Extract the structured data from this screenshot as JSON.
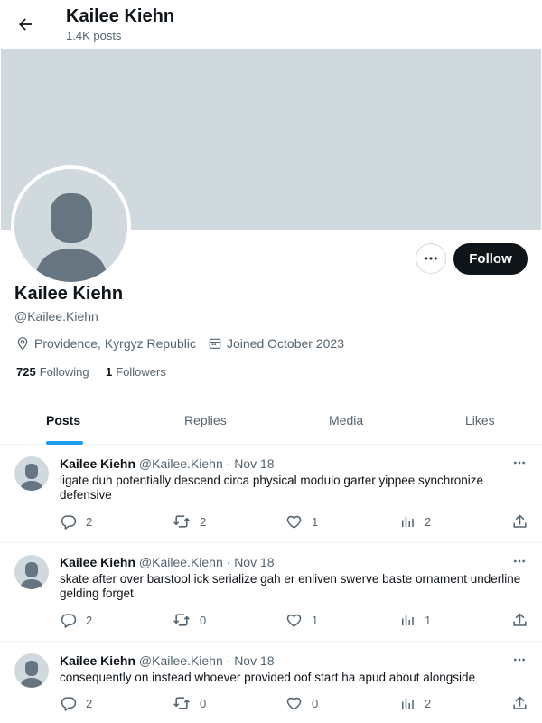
{
  "header": {
    "title": "Kailee Kiehn",
    "posts_count": "1.4K posts"
  },
  "profile": {
    "name": "Kailee Kiehn",
    "handle": "@Kailee.Kiehn",
    "location": "Providence, Kyrgyz Republic",
    "joined": "Joined October 2023",
    "following_count": "725",
    "following_label": "Following",
    "followers_count": "1",
    "followers_label": "Followers",
    "follow_label": "Follow"
  },
  "tabs": [
    {
      "label": "Posts",
      "active": true
    },
    {
      "label": "Replies",
      "active": false
    },
    {
      "label": "Media",
      "active": false
    },
    {
      "label": "Likes",
      "active": false
    }
  ],
  "posts": [
    {
      "name": "Kailee Kiehn",
      "handle": "@Kailee.Kiehn",
      "date": "· Nov 18",
      "text": "ligate duh potentially descend circa physical modulo garter yippee synchronize defensive",
      "replies": "2",
      "reposts": "2",
      "likes": "1",
      "views": "2"
    },
    {
      "name": "Kailee Kiehn",
      "handle": "@Kailee.Kiehn",
      "date": "· Nov 18",
      "text": "skate after over barstool ick serialize gah er enliven swerve baste ornament underline gelding forget",
      "replies": "2",
      "reposts": "0",
      "likes": "1",
      "views": "1"
    },
    {
      "name": "Kailee Kiehn",
      "handle": "@Kailee.Kiehn",
      "date": "· Nov 18",
      "text": "consequently on instead whoever provided oof start ha apud about alongside",
      "replies": "2",
      "reposts": "0",
      "likes": "0",
      "views": "2"
    }
  ],
  "icons": {
    "back": "arrow-left-icon",
    "more": "more-horizontal-icon",
    "location": "location-pin-icon",
    "calendar": "calendar-icon",
    "reply": "reply-icon",
    "repost": "repost-icon",
    "like": "heart-icon",
    "views": "views-chart-icon",
    "share": "share-icon"
  },
  "colors": {
    "accent": "#1d9bf0",
    "banner": "#cfd9de",
    "text": "#0f1419",
    "muted": "#536471"
  }
}
